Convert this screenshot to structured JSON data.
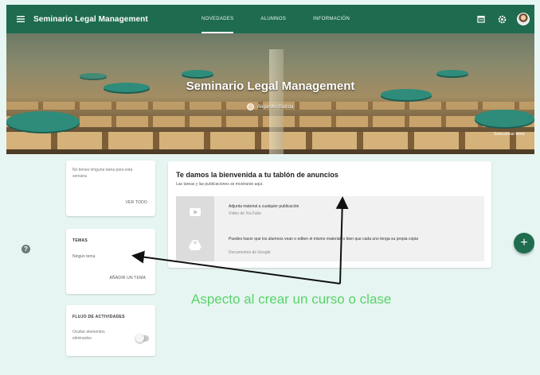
{
  "topbar": {
    "title": "Seminario Legal Management",
    "tabs": [
      "NOVEDADES",
      "ALUMNOS",
      "INFORMACIÓN"
    ],
    "active_tab": 0,
    "colors": {
      "bar": "#1e6b4f"
    },
    "icons": [
      "menu-icon",
      "calendar-icon",
      "settings-icon",
      "avatar"
    ]
  },
  "banner": {
    "title": "Seminario Legal Management",
    "owner": "Alejandro Batista",
    "corner_text": "Seleccionar tema"
  },
  "upcoming": {
    "text": "No tienes ninguna tarea para esta semana",
    "link": "VER TODO"
  },
  "topics": {
    "title": "TEMAS",
    "empty": "Ningún tema",
    "link": "AÑADIR UN TEMA"
  },
  "stream": {
    "title": "FLUJO DE ACTIVIDADES",
    "text": "Ocultar elementos eliminados",
    "toggle_on": false
  },
  "main": {
    "welcome_title": "Te damos la bienvenida a tu tablón de anuncios",
    "welcome_sub": "Las tareas y las publicaciones se mostrarán aquí.",
    "tips": [
      {
        "icon": "youtube-icon",
        "title": "Adjunta material a cualquier publicación",
        "sub": "Vídeo de YouTube"
      },
      {
        "icon": "drive-icon",
        "title": "Puedes hacer que los alumnos vean o editen el mismo material, o bien que cada uno tenga su propia copia",
        "sub": "Documentos de Google"
      }
    ]
  },
  "caption": "Aspecto al crear un curso o clase",
  "colors": {
    "accent": "#1e6b4f",
    "caption": "#5ad36a",
    "background": "#e6f5f2"
  }
}
